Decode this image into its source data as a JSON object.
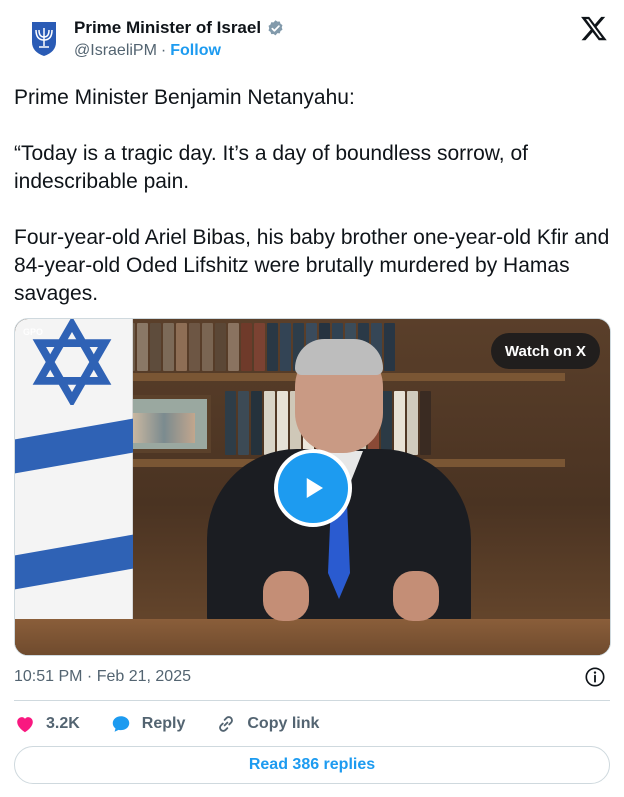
{
  "author": {
    "name": "Prime Minister of Israel",
    "handle": "@IsraeliPM",
    "separator": "·",
    "follow_label": "Follow",
    "avatar_icon": "menorah-emblem-icon",
    "verified_icon": "verified-badge-icon"
  },
  "platform": {
    "logo_icon": "x-logo-icon"
  },
  "tweet": {
    "paragraphs": [
      "Prime Minister Benjamin Netanyahu:",
      "“Today is a tragic day. It’s a day of boundless sorrow, of indescribable pain.",
      "Four-year-old Ariel Bibas, his baby brother one-year-old Kfir and 84-year-old Oded Lifshitz were brutally murdered by Hamas savages."
    ]
  },
  "media": {
    "watch_label": "Watch on X",
    "play_icon": "play-icon",
    "watermark": "GPO"
  },
  "meta": {
    "timestamp": "10:51 PM · Feb 21, 2025",
    "info_icon": "info-icon"
  },
  "actions": {
    "like_count": "3.2K",
    "reply_label": "Reply",
    "copy_label": "Copy link"
  },
  "footer": {
    "read_replies_label": "Read 386 replies"
  },
  "colors": {
    "accent": "#1d9bf0",
    "like": "#f91880",
    "text_primary": "#0f1419",
    "text_secondary": "#536471",
    "border": "#cfd9de"
  }
}
